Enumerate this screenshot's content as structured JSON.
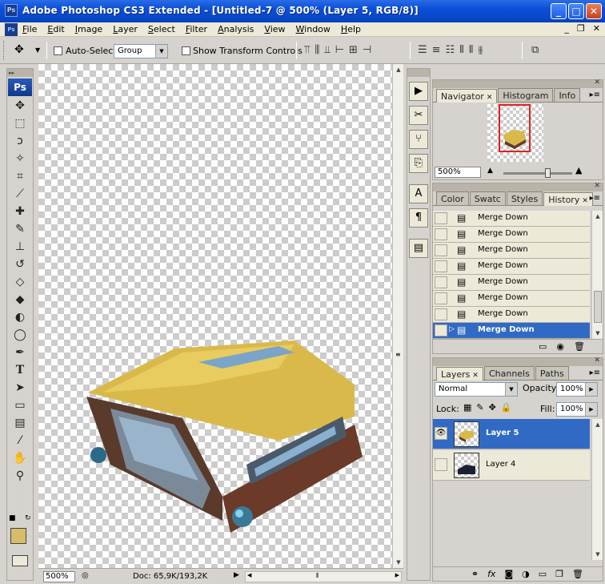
{
  "window": {
    "title": "Adobe Photoshop CS3 Extended - [Untitled-7 @ 500% (Layer 5, RGB/8)]",
    "minimize": "_",
    "maximize": "□",
    "close": "✕",
    "app_badge": "Ps"
  },
  "menu": {
    "items": [
      "File",
      "Edit",
      "Image",
      "Layer",
      "Select",
      "Filter",
      "Analysis",
      "View",
      "Window",
      "Help"
    ],
    "mdi": [
      "_",
      "❐",
      "✕"
    ]
  },
  "options": {
    "auto_select_label": "Auto-Select:",
    "auto_select_value": "Group",
    "transform_label": "Show Transform Controls"
  },
  "toolbox": {
    "logo": "Ps",
    "foreground_color": "#d6bd6c"
  },
  "status": {
    "zoom": "500%",
    "doc_info": "Doc: 65,9K/193,2K"
  },
  "navigator": {
    "tabs": [
      "Navigator",
      "Histogram",
      "Info"
    ],
    "zoom": "500%"
  },
  "history": {
    "tabs": [
      "Color",
      "Swatc",
      "Styles",
      "History"
    ],
    "items": [
      "Merge Down",
      "Merge Down",
      "Merge Down",
      "Merge Down",
      "Merge Down",
      "Merge Down",
      "Merge Down",
      "Merge Down"
    ],
    "selected_index": 7
  },
  "layers": {
    "tabs": [
      "Layers",
      "Channels",
      "Paths"
    ],
    "blend_mode": "Normal",
    "opacity_label": "Opacity:",
    "opacity_value": "100%",
    "lock_label": "Lock:",
    "fill_label": "Fill:",
    "fill_value": "100%",
    "items": [
      {
        "name": "Layer 5",
        "visible": true,
        "selected": true
      },
      {
        "name": "Layer 4",
        "visible": false,
        "selected": false
      }
    ]
  },
  "colors": {
    "titlebar": "#0a4fd6",
    "selection": "#316ac5",
    "navigator_box": "#e02020"
  }
}
